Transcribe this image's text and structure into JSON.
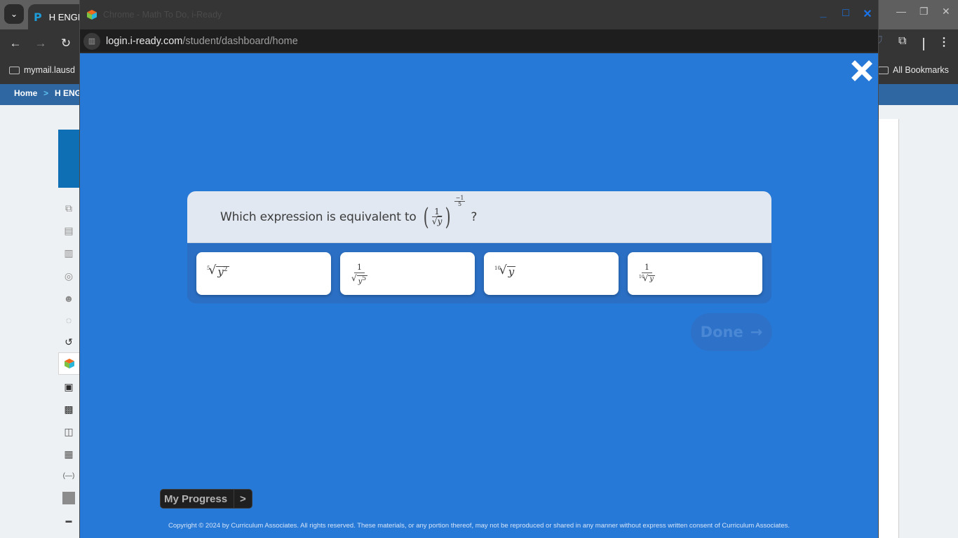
{
  "background_browser": {
    "tab_title": "H ENGL",
    "bookmark_left": "mymail.lausd",
    "bookmark_right": "All Bookmarks",
    "breadcrumb": [
      {
        "label": "Home"
      },
      {
        "label": "H ENG"
      }
    ],
    "breadcrumb_separator": ">"
  },
  "popup": {
    "window_title": "Chrome - Math To Do, i-Ready",
    "url_domain": "login.i-ready.com",
    "url_path": "/student/dashboard/home",
    "colors": {
      "stage": "#2779d8",
      "question_header": "#e1e8f1",
      "accent_window_controls": "#1a73e8"
    }
  },
  "question": {
    "prompt": "Which expression is equivalent to",
    "expression": {
      "base_numerator": "1",
      "base_denominator_radicand": "y",
      "exponent_numerator": "−1",
      "exponent_denominator": "5"
    },
    "question_mark": "?",
    "answers": [
      {
        "id": "A",
        "latex": "\\sqrt[5]{y^2}",
        "index": "5",
        "radicand": "y",
        "power": "2"
      },
      {
        "id": "B",
        "latex": "\\frac{1}{\\sqrt{y^5}}",
        "numerator": "1",
        "radicand": "y",
        "power": "5"
      },
      {
        "id": "C",
        "latex": "\\sqrt[10]{y}",
        "index": "10",
        "radicand": "y"
      },
      {
        "id": "D",
        "latex": "\\frac{1}{\\sqrt[10]{y}}",
        "numerator": "1",
        "index": "10",
        "radicand": "y"
      }
    ]
  },
  "done_button": {
    "label": "Done",
    "arrow": "→",
    "enabled": false
  },
  "my_progress": {
    "label": "My Progress",
    "arrow": ">"
  },
  "copyright": "Copyright © 2024 by Curriculum Associates. All rights reserved. These materials, or any portion thereof, may not be reproduced or shared in any manner without express written consent of Curriculum Associates."
}
